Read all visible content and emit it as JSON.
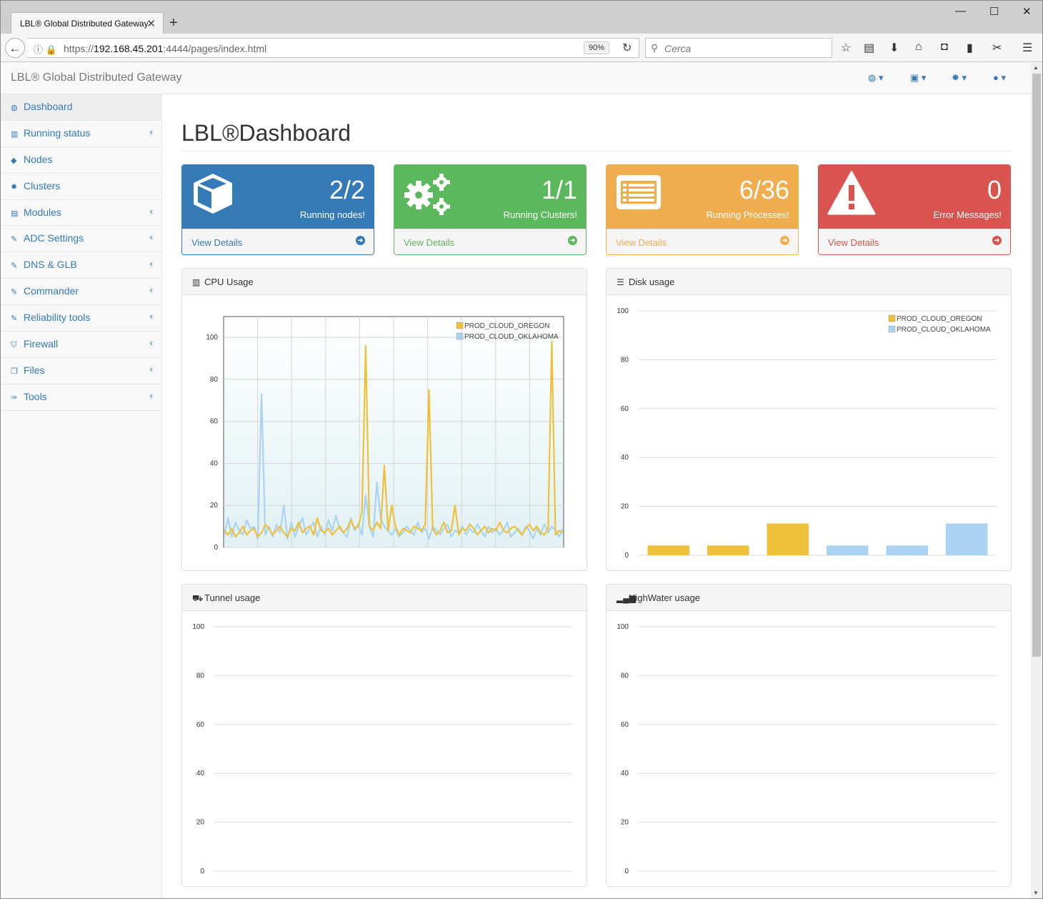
{
  "browser": {
    "tab_title": "LBL® Global Distributed Gateway",
    "url_prefix": "https://",
    "url_host": "192.168.45.201",
    "url_rest": ":4444/pages/index.html",
    "zoom": "90%",
    "search_placeholder": "Cerca"
  },
  "app": {
    "brand": "LBL® Global Distributed Gateway",
    "top_menu": [
      {
        "icon": "dashboard-icon",
        "glyph": "◍ ▾"
      },
      {
        "icon": "save-icon",
        "glyph": "▣ ▾"
      },
      {
        "icon": "gear-icon",
        "glyph": "✹ ▾"
      },
      {
        "icon": "user-icon",
        "glyph": "● ▾"
      }
    ]
  },
  "sidebar": {
    "items": [
      {
        "label": "Dashboard",
        "icon": "dashboard-icon",
        "glyph": "◍",
        "submenu": false,
        "active": true
      },
      {
        "label": "Running status",
        "icon": "bar-chart-icon",
        "glyph": "▥",
        "submenu": true
      },
      {
        "label": "Nodes",
        "icon": "cube-icon",
        "glyph": "◆",
        "submenu": false
      },
      {
        "label": "Clusters",
        "icon": "gears-icon",
        "glyph": "✹",
        "submenu": false
      },
      {
        "label": "Modules",
        "icon": "list-icon",
        "glyph": "▤",
        "submenu": true
      },
      {
        "label": "ADC Settings",
        "icon": "edit-icon",
        "glyph": "✎",
        "submenu": true
      },
      {
        "label": "DNS & GLB",
        "icon": "edit-icon",
        "glyph": "✎",
        "submenu": true
      },
      {
        "label": "Commander",
        "icon": "edit-icon",
        "glyph": "✎",
        "submenu": true
      },
      {
        "label": "Reliability tools",
        "icon": "edit-icon",
        "glyph": "✎",
        "submenu": true
      },
      {
        "label": "Firewall",
        "icon": "shield-icon",
        "glyph": "⛉",
        "submenu": true
      },
      {
        "label": "Files",
        "icon": "files-icon",
        "glyph": "❐",
        "submenu": true
      },
      {
        "label": "Tools",
        "icon": "wrench-icon",
        "glyph": "✑",
        "submenu": true
      }
    ]
  },
  "page": {
    "title": "LBL®Dashboard"
  },
  "cards": [
    {
      "value": "2/2",
      "label": "Running nodes!",
      "link": "View Details",
      "color": "#337ab7",
      "icon": "cube-icon"
    },
    {
      "value": "1/1",
      "label": "Running Clusters!",
      "link": "View Details",
      "color": "#5cb85c",
      "icon": "gears-icon"
    },
    {
      "value": "6/36",
      "label": "Running Processes!",
      "link": "View Details",
      "color": "#f0ad4e",
      "icon": "list-icon"
    },
    {
      "value": "0",
      "label": "Error Messages!",
      "link": "View Details",
      "color": "#d9534f",
      "icon": "warning-icon"
    }
  ],
  "panels": {
    "cpu": "CPU Usage",
    "disk": "Disk usage",
    "tunnel": "Tunnel usage",
    "highwater": "HighWater usage"
  },
  "chart_data": [
    {
      "type": "line",
      "title": "CPU Usage",
      "ylim": [
        0,
        100
      ],
      "yticks": [
        "100",
        "80",
        "60",
        "40",
        "20",
        "0"
      ],
      "series": [
        {
          "name": "PROD_CLOUD_OREGON",
          "color": "#efc03a",
          "values": [
            8,
            6,
            9,
            5,
            7,
            10,
            6,
            8,
            9,
            5,
            7,
            11,
            9,
            6,
            8,
            10,
            7,
            5,
            9,
            8,
            12,
            7,
            9,
            10,
            6,
            14,
            8,
            7,
            9,
            6,
            8,
            10,
            7,
            9,
            13,
            9,
            10,
            17,
            96,
            10,
            8,
            12,
            9,
            39,
            8,
            20,
            10,
            6,
            9,
            8,
            7,
            10,
            9,
            8,
            11,
            75,
            9,
            6,
            8,
            12,
            7,
            8,
            20,
            6,
            9,
            8,
            11,
            9,
            6,
            8,
            10,
            7,
            9,
            8,
            12,
            8,
            7,
            9,
            10,
            8,
            6,
            9,
            11,
            8,
            10,
            7,
            6,
            9,
            98,
            6,
            8,
            7
          ]
        },
        {
          "name": "PROD_CLOUD_OKLAHOMA",
          "color": "#aad3f2",
          "values": [
            6,
            14,
            5,
            12,
            8,
            6,
            13,
            9,
            10,
            4,
            73,
            6,
            10,
            5,
            11,
            7,
            20,
            4,
            12,
            5,
            10,
            14,
            6,
            9,
            12,
            5,
            10,
            6,
            13,
            8,
            15,
            9,
            7,
            5,
            14,
            8,
            11,
            6,
            25,
            10,
            5,
            31,
            14,
            10,
            8,
            6,
            9,
            5,
            7,
            10,
            8,
            6,
            12,
            7,
            9,
            4,
            10,
            8,
            6,
            9,
            11,
            5,
            8,
            7,
            10,
            6,
            9,
            7,
            11,
            8,
            5,
            10,
            7,
            9,
            6,
            8,
            12,
            5,
            7,
            9,
            6,
            10,
            8,
            4,
            9,
            6,
            11,
            7,
            10,
            8,
            5,
            9
          ]
        }
      ]
    },
    {
      "type": "bar",
      "title": "Disk usage",
      "ylim": [
        0,
        100
      ],
      "yticks": [
        "100",
        "80",
        "60",
        "40",
        "20",
        "0"
      ],
      "series": [
        {
          "name": "PROD_CLOUD_OREGON",
          "color": "#efc03a",
          "values": [
            4,
            4,
            13
          ]
        },
        {
          "name": "PROD_CLOUD_OKLAHOMA",
          "color": "#aad3f2",
          "values": [
            4,
            4,
            13
          ]
        }
      ]
    },
    {
      "type": "bar",
      "title": "Tunnel usage",
      "ylim": [
        0,
        100
      ],
      "yticks": [
        "100",
        "80",
        "60",
        "40",
        "20",
        "0"
      ],
      "series": []
    },
    {
      "type": "bar",
      "title": "HighWater usage",
      "ylim": [
        0,
        100
      ],
      "yticks": [
        "100",
        "80",
        "60",
        "40",
        "20",
        "0"
      ],
      "series": []
    }
  ]
}
